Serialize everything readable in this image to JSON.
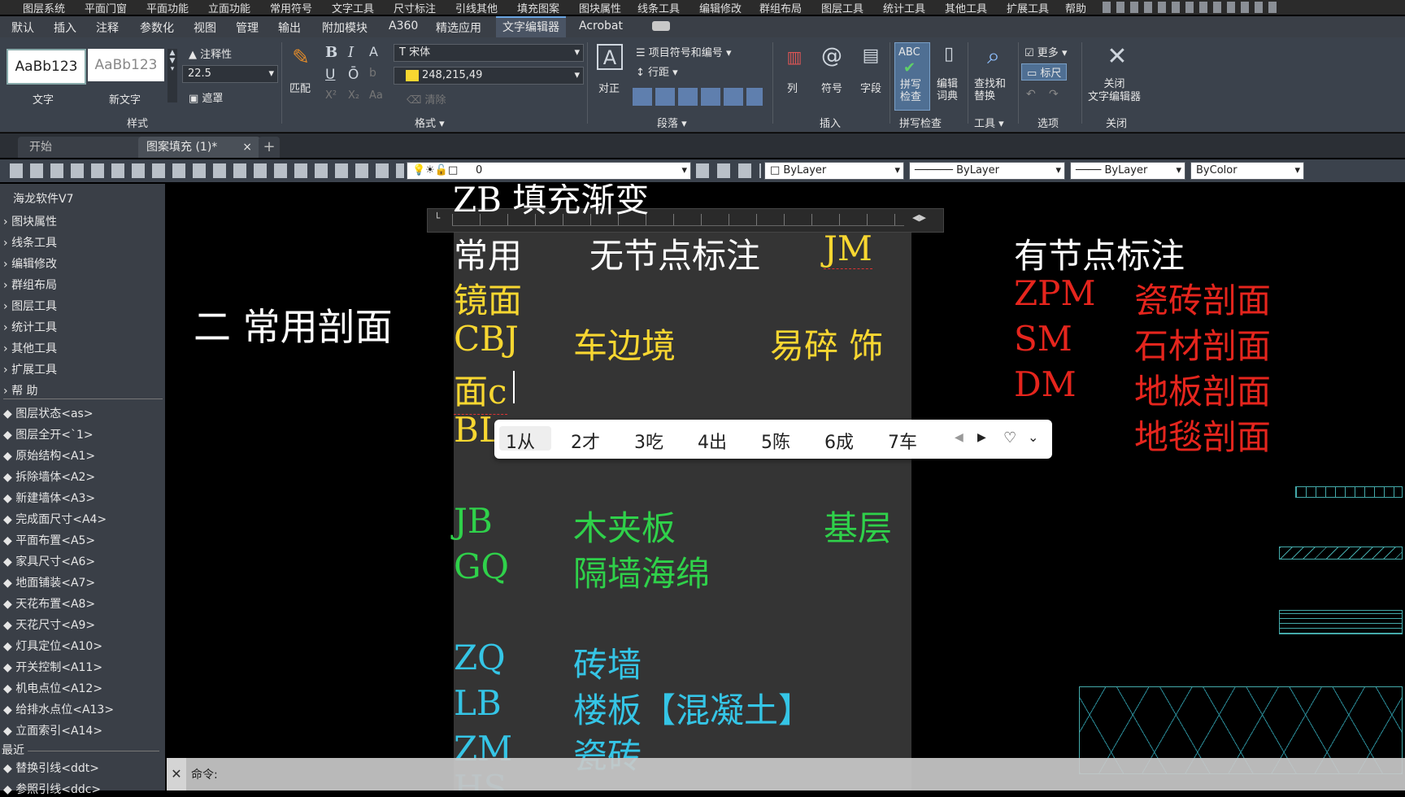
{
  "menu": [
    "图层系统",
    "平面门窗",
    "平面功能",
    "立面功能",
    "常用符号",
    "文字工具",
    "尺寸标注",
    "引线其他",
    "填充图案",
    "图块属性",
    "线条工具",
    "编辑修改",
    "群组布局",
    "图层工具",
    "统计工具",
    "其他工具",
    "扩展工具",
    "帮助"
  ],
  "ribbon_tabs": [
    "默认",
    "插入",
    "注释",
    "参数化",
    "视图",
    "管理",
    "输出",
    "附加模块",
    "A360",
    "精选应用",
    "文字编辑器",
    "Acrobat"
  ],
  "ribbon_active": "文字编辑器",
  "ribbon": {
    "style_sample_1": "AaBb123",
    "style_sample_1_label": "文字",
    "style_sample_2": "AaBb123",
    "style_sample_2_label": "新文字",
    "annotative": "注释性",
    "text_height": "22.5",
    "mask": "遮罩",
    "panel_style": "样式",
    "match": "匹配",
    "font": "宋体",
    "color": "248,215,49",
    "clear": "清除",
    "panel_format": "格式",
    "bullets": "项目符号和编号",
    "line_spacing": "行距",
    "justify": "对正",
    "panel_paragraph": "段落",
    "column": "列",
    "symbol": "符号",
    "field": "字段",
    "panel_insert": "插入",
    "spell_check": "拼写\n检查",
    "edit_dict": "编辑\n词典",
    "panel_spell": "拼写检查",
    "find_replace": "查找和\n替换",
    "panel_tools": "工具",
    "more": "更多",
    "ruler": "标尺",
    "panel_options": "选项",
    "close_editor": "关闭\n文字编辑器",
    "panel_close": "关闭",
    "spell_icon_text": "ABC"
  },
  "file_tabs": [
    "开始",
    "图案填充 (1)*"
  ],
  "toolbar2": {
    "layer": "0",
    "color": "ByLayer",
    "linetype": "ByLayer",
    "lineweight": "ByLayer",
    "plotstyle": "ByColor"
  },
  "left_panel": {
    "title": "海龙软件V7",
    "groups": [
      "图块属性",
      "线条工具",
      "编辑修改",
      "群组布局",
      "图层工具",
      "统计工具",
      "其他工具",
      "扩展工具",
      "帮  助"
    ],
    "commands": [
      "图层状态<as>",
      "图层全开<`1>",
      "原始结构<A1>",
      "拆除墙体<A2>",
      "新建墙体<A3>",
      "完成面尺寸<A4>",
      "平面布置<A5>",
      "家具尺寸<A6>",
      "地面铺装<A7>",
      "天花布置<A8>",
      "天花尺寸<A9>",
      "灯具定位<A10>",
      "开关控制<A11>",
      "机电点位<A12>",
      "给排水点位<A13>",
      "立面索引<A14>"
    ],
    "recent_title": "最近",
    "recent": [
      "替换引线<ddt>",
      "参照引线<ddc>"
    ]
  },
  "canvas": {
    "top_cut": "ZB   填充渐变",
    "section_title": "二  常用剖面",
    "col1_header": "常用",
    "col2_header": "无节点标注",
    "jm": "JM",
    "mirror": "镜面",
    "cbj": "CBJ",
    "cbj_name": "车边境",
    "fragile": "易碎  饰",
    "typed_line": "面c",
    "bl": "BL",
    "jb": "JB",
    "jb_name": "木夹板",
    "base": "基层",
    "gq": "GQ",
    "gq_name": "隔墙海绵",
    "zq": "ZQ",
    "zq_name": "砖墙",
    "lb": "LB",
    "lb_name": "楼板【混凝土】",
    "zm": "ZM",
    "zm_name": "瓷砖",
    "hs": "HS",
    "right_header": "有节点标注",
    "zpm": "ZPM",
    "zpm_name": "瓷砖剖面",
    "sm": "SM",
    "sm_name": "石材剖面",
    "dm": "DM",
    "dm_name": "地板剖面",
    "dt_name": "地毯剖面",
    "command_label": "命令:"
  },
  "ime": {
    "candidates": [
      "1从",
      "2才",
      "3吃",
      "4出",
      "5陈",
      "6成",
      "7车"
    ]
  },
  "colors": {
    "yellow": "#f8d731",
    "green": "#2fd14a",
    "cyan": "#35c5e6",
    "red": "#e5251d",
    "white": "#ffffff"
  }
}
